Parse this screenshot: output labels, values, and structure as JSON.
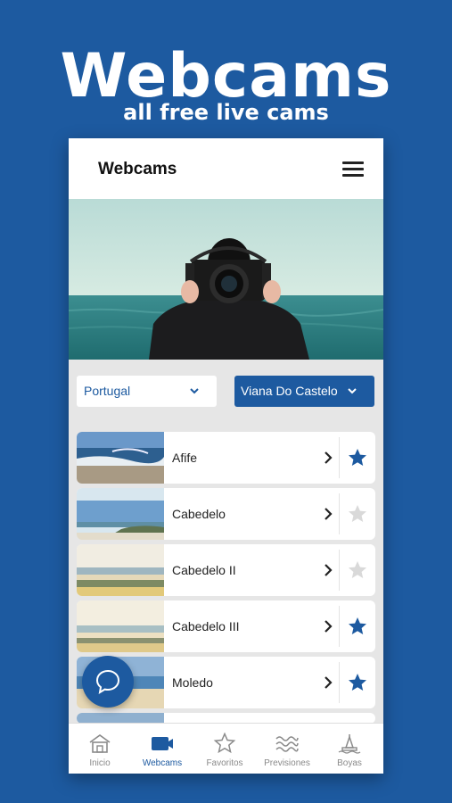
{
  "promo": {
    "title": "Webcams",
    "subtitle": "all free live cams"
  },
  "app": {
    "header_title": "Webcams",
    "menu_icon": "hamburger-menu-icon"
  },
  "filters": {
    "country": "Portugal",
    "region": "Viana Do Castelo"
  },
  "webcams": [
    {
      "name": "Afife",
      "favorite": true
    },
    {
      "name": "Cabedelo",
      "favorite": false
    },
    {
      "name": "Cabedelo II",
      "favorite": false
    },
    {
      "name": "Cabedelo III",
      "favorite": true
    },
    {
      "name": "Moledo",
      "favorite": true
    }
  ],
  "bottom_nav": [
    {
      "label": "Inicio",
      "icon": "home-icon",
      "active": false
    },
    {
      "label": "Webcams",
      "icon": "video-camera-icon",
      "active": true
    },
    {
      "label": "Favoritos",
      "icon": "star-icon",
      "active": false
    },
    {
      "label": "Previsiones",
      "icon": "waves-icon",
      "active": false
    },
    {
      "label": "Boyas",
      "icon": "buoy-icon",
      "active": false
    }
  ],
  "colors": {
    "brand_blue": "#1d5aa0",
    "star_inactive": "#d9d9d9",
    "nav_inactive": "#8a8a8a"
  }
}
